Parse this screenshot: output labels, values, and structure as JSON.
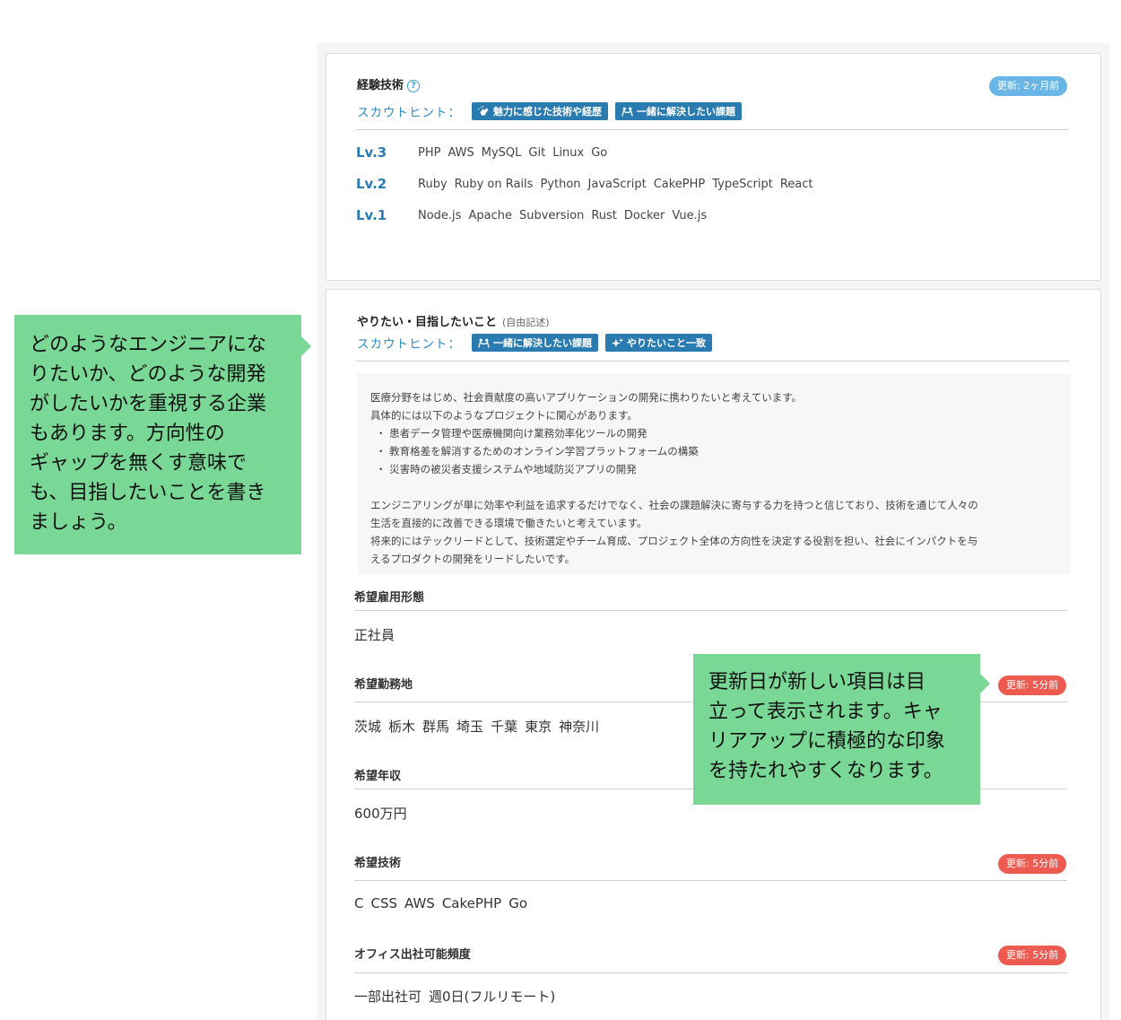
{
  "skills": {
    "title": "経験技術",
    "help_icon": "?",
    "updated_badge": "更新: 2ヶ月前",
    "hint_label": "スカウトヒント：",
    "hint_tags": [
      "魅力に感じた技術や経歴",
      "一緒に解決したい課題"
    ],
    "levels": [
      {
        "label": "Lv.3",
        "techs": [
          "PHP",
          "AWS",
          "MySQL",
          "Git",
          "Linux",
          "Go"
        ]
      },
      {
        "label": "Lv.2",
        "techs": [
          "Ruby",
          "Ruby on Rails",
          "Python",
          "JavaScript",
          "CakePHP",
          "TypeScript",
          "React"
        ]
      },
      {
        "label": "Lv.1",
        "techs": [
          "Node.js",
          "Apache",
          "Subversion",
          "Rust",
          "Docker",
          "Vue.js"
        ]
      }
    ]
  },
  "wish": {
    "title": "やりたい・目指したいこと",
    "note": "(自由記述)",
    "hint_label": "スカウトヒント：",
    "hint_tags": [
      "一緒に解決したい課題",
      "やりたいこと一致"
    ],
    "free_text": {
      "l1": "医療分野をはじめ、社会貢献度の高いアプリケーションの開発に携わりたいと考えています。",
      "l2": "具体的には以下のようなプロジェクトに関心があります。",
      "b1": "・ 患者データ管理や医療機関向け業務効率化ツールの開発",
      "b2": "・ 教育格差を解消するためのオンライン学習プラットフォームの構築",
      "b3": "・ 災害時の被災者支援システムや地域防災アプリの開発",
      "l3": "エンジニアリングが単に効率や利益を追求するだけでなく、社会の課題解決に寄与する力を持つと信じており、技術を通じて人々の",
      "l4": "生活を直接的に改善できる環境で働きたいと考えています。",
      "l5": "将来的にはテックリードとして、技術選定やチーム育成、プロジェクト全体の方向性を決定する役割を担い、社会にインパクトを与",
      "l6": "えるプロダクトの開発をリードしたいです。"
    }
  },
  "fields": {
    "employment": {
      "title": "希望雇用形態",
      "values": [
        "正社員"
      ]
    },
    "location": {
      "title": "希望勤務地",
      "badge": "更新: 5分前",
      "values": [
        "茨城",
        "栃木",
        "群馬",
        "埼玉",
        "千葉",
        "東京",
        "神奈川"
      ]
    },
    "salary": {
      "title": "希望年収",
      "values": [
        "600万円"
      ]
    },
    "tech": {
      "title": "希望技術",
      "badge": "更新: 5分前",
      "values": [
        "C",
        "CSS",
        "AWS",
        "CakePHP",
        "Go"
      ]
    },
    "office": {
      "title": "オフィス出社可能頻度",
      "badge": "更新: 5分前",
      "values": [
        "一部出社可",
        "週0日(フルリモート)"
      ]
    }
  },
  "callouts": {
    "left": [
      "どのようなエンジニアにな",
      "りたいか、どのような開発",
      "がしたいかを重視する企業",
      "もあります。方向性の",
      "ギャップを無くす意味で",
      "も、目指したいことを書き",
      "ましょう。"
    ],
    "right": [
      "更新日が新しい項目は目",
      "立って表示されます。キャ",
      "リアアップに積極的な印象",
      "を持たれやすくなります。"
    ]
  },
  "colors": {
    "accent_blue": "#2a7bb0",
    "hint_blue": "#2a8ac7",
    "badge_blue": "#68b5e6",
    "badge_red": "#ec5a50",
    "callout_green": "#7ad896"
  }
}
